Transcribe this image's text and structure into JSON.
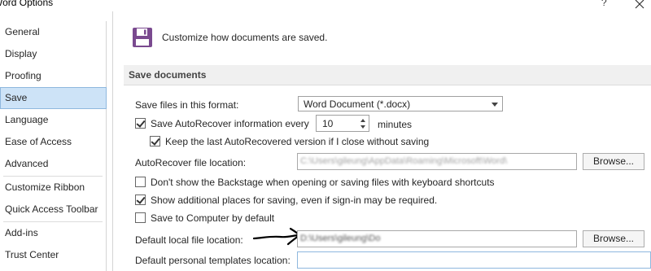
{
  "window": {
    "title": "Word Options",
    "help_glyph": "?",
    "close_icon": "close-icon"
  },
  "sidebar": {
    "items": [
      {
        "label": "General"
      },
      {
        "label": "Display"
      },
      {
        "label": "Proofing"
      },
      {
        "label": "Save",
        "active": true
      },
      {
        "label": "Language"
      },
      {
        "label": "Ease of Access"
      },
      {
        "label": "Advanced"
      },
      {
        "label": "Customize Ribbon"
      },
      {
        "label": "Quick Access Toolbar"
      },
      {
        "label": "Add-ins"
      },
      {
        "label": "Trust Center"
      }
    ]
  },
  "header": {
    "icon": "floppy-disk-icon",
    "text": "Customize how documents are saved."
  },
  "section": {
    "title": "Save documents"
  },
  "save_format": {
    "label": "Save files in this format:",
    "value": "Word Document (*.docx)"
  },
  "autorecover": {
    "label": "Save AutoRecover information every",
    "checked": true,
    "minutes_value": "10",
    "minutes_label": "minutes"
  },
  "keep_last": {
    "label": "Keep the last AutoRecovered version if I close without saving",
    "checked": true
  },
  "autorecover_location": {
    "label": "AutoRecover file location:",
    "value": "C:\\Users\\gileung\\AppData\\Roaming\\Microsoft\\Word\\",
    "browse_label": "Browse..."
  },
  "dont_show_backstage": {
    "label": "Don't show the Backstage when opening or saving files with keyboard shortcuts",
    "checked": false
  },
  "show_additional": {
    "label": "Show additional places for saving, even if sign-in may be required.",
    "checked": true
  },
  "save_to_computer": {
    "label": "Save to Computer by default",
    "checked": false
  },
  "default_local": {
    "label": "Default local file location:",
    "value": "D:\\Users\\gileung\\Do",
    "browse_label": "Browse..."
  },
  "default_templates": {
    "label": "Default personal templates location:",
    "value": ""
  },
  "colors": {
    "active_nav_bg": "#cde3f7",
    "active_nav_border": "#8fb8de",
    "section_bg": "#f0f0f0",
    "disk_icon": "#7a4a8f"
  }
}
